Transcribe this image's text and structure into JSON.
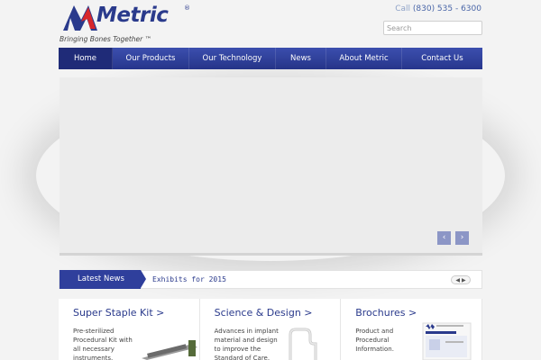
{
  "header": {
    "logo_text": "Metric",
    "logo_reg": "®",
    "tagline": "Bringing Bones Together ™",
    "phone_label": "Call",
    "phone_number": "(830) 535 - 6300",
    "search_placeholder": "Search"
  },
  "nav": {
    "items": [
      {
        "label": "Home"
      },
      {
        "label": "Our Products"
      },
      {
        "label": "Our Technology"
      },
      {
        "label": "News"
      },
      {
        "label": "About Metric"
      },
      {
        "label": "Contact Us"
      }
    ]
  },
  "slider": {
    "prev_icon": "‹",
    "next_icon": "›"
  },
  "news": {
    "tag": "Latest News",
    "headline": "Exhibits for 2015",
    "ctrl_icon": "◀ ▶"
  },
  "cards": [
    {
      "title": "Super Staple Kit >",
      "desc": "Pre-sterilized Procedural Kit with all necessary instruments."
    },
    {
      "title": "Science & Design >",
      "desc": "Advances in implant material and design to improve the Standard of Care."
    },
    {
      "title": "Brochures >",
      "desc": "Product and Procedural Information."
    }
  ],
  "colors": {
    "brand_blue": "#2a3a8c",
    "logo_red": "#d7262b",
    "nav_active": "#1f2b78"
  }
}
